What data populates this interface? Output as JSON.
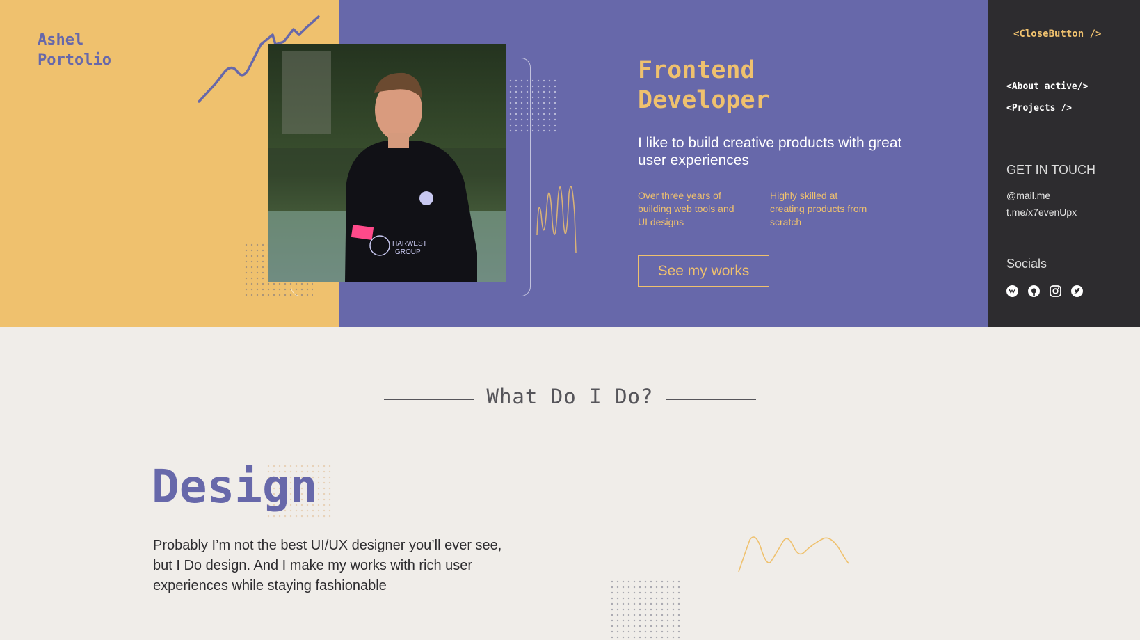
{
  "brand": {
    "line1": "Ashel",
    "line2": "Portolio"
  },
  "hero": {
    "title_line1": "Frontend",
    "title_line2": "Developer",
    "subtitle": "I like to build creative products with great user experiences",
    "fact1": "Over three years of building web tools and UI designs",
    "fact2": "Highly skilled at creating products from scratch",
    "cta": "See my works",
    "photo_text1": "HARWEST",
    "photo_text2": "GROUP"
  },
  "sidebar": {
    "close": "<CloseButton />",
    "nav": [
      {
        "label": "<About active/>"
      },
      {
        "label": "<Projects />"
      }
    ],
    "contact_heading": "GET IN TOUCH",
    "email": "@mail.me",
    "telegram": "t.me/x7evenUpx",
    "socials_heading": "Socials",
    "socials": [
      "vk-icon",
      "github-icon",
      "instagram-icon",
      "twitter-icon"
    ]
  },
  "about": {
    "heading": "What Do I Do?",
    "design_title": "Design",
    "design_text": "Probably I’m not the best UI/UX designer you’ll ever see, but I Do design. And I make my works with rich user experiences while staying fashionable"
  },
  "colors": {
    "yellow": "#efc16e",
    "purple": "#6768aa",
    "dark": "#2d2c2f",
    "background": "#f0ede9"
  }
}
